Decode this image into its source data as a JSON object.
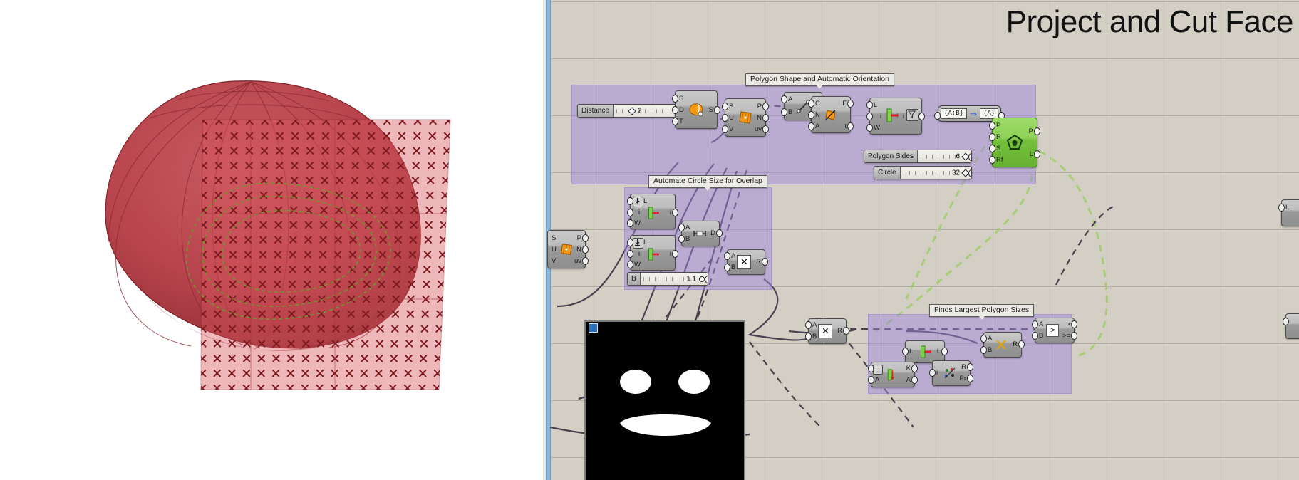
{
  "window": {
    "title": "Project and Cut Face"
  },
  "viewport": {
    "name": "rhino-viewport",
    "description": "Shaded red lofted blob surface with a translucent red rectangular mesh plane covered in X cross markers and green dashed curve overlay",
    "shape_color": "#b03b45",
    "plane_color": "#e09a9d",
    "marker_color": "#8c1c22",
    "curve_color": "#5f8f2a"
  },
  "canvas": {
    "background": "#d4cfc4",
    "grid_color": "#96918 7",
    "group_color": "#9f84e0",
    "wire_color": "#4a4050",
    "green_wire_color": "#a8cc7a"
  },
  "groups": [
    {
      "id": "g1",
      "label": "Polygon Shape and Automatic Orientation"
    },
    {
      "id": "g2",
      "label": "Automate Circle Size for Overlap"
    },
    {
      "id": "g3",
      "label": "Finds Largest Polygon Sizes"
    }
  ],
  "sliders": [
    {
      "name": "Distance",
      "value": "2",
      "knob": "diamond"
    },
    {
      "name": "Polygon Sides",
      "value": "6",
      "knob": "diamond"
    },
    {
      "name": "Circle",
      "value": "32",
      "knob": "diamond"
    },
    {
      "name": "B",
      "value": "1.1",
      "knob": "round"
    }
  ],
  "mapper": {
    "from": "{A;B}",
    "to": "{A}",
    "arrow": "⇒"
  },
  "components": [
    {
      "id": "c-divide",
      "icon": "divide-surface-icon",
      "inputs": [
        "S",
        "D",
        "T"
      ],
      "outputs": [
        "S"
      ]
    },
    {
      "id": "c-evalsrf1",
      "icon": "evaluate-surface-icon",
      "inputs": [
        "S",
        "U",
        "V"
      ],
      "outputs": [
        "P",
        "N",
        "uv"
      ]
    },
    {
      "id": "c-line",
      "icon": "line-icon",
      "inputs": [
        "A",
        "B"
      ],
      "outputs": [
        "L"
      ]
    },
    {
      "id": "c-planenorm",
      "icon": "plane-normal-icon",
      "inputs": [
        "C",
        "N",
        "A"
      ],
      "outputs": [
        "F",
        "t"
      ]
    },
    {
      "id": "c-flip1",
      "icon": "flip-plane-icon",
      "inputs": [
        "L",
        "i",
        "W"
      ],
      "outputs": [
        "i",
        "filter"
      ]
    },
    {
      "id": "c-pathmap",
      "icon": "path-mapper-icon",
      "inputs": [],
      "outputs": []
    },
    {
      "id": "c-polygon",
      "icon": "polygon-icon",
      "inputs": [
        "P",
        "R",
        "S",
        "Rf"
      ],
      "outputs": [
        "P",
        "L"
      ],
      "color": "green"
    },
    {
      "id": "c-evalsrf2",
      "icon": "evaluate-surface-icon",
      "inputs": [
        "S",
        "U",
        "V"
      ],
      "outputs": [
        "P",
        "N",
        "uv"
      ]
    },
    {
      "id": "c-flip2",
      "icon": "flip-plane-icon",
      "inputs": [
        "L",
        "i",
        "W"
      ],
      "outputs": [
        "i"
      ]
    },
    {
      "id": "c-flip3",
      "icon": "flip-plane-icon",
      "inputs": [
        "L",
        "i",
        "W"
      ],
      "outputs": [
        "i"
      ]
    },
    {
      "id": "c-dist",
      "icon": "distance-icon",
      "inputs": [
        "A",
        "B"
      ],
      "outputs": [
        "D"
      ]
    },
    {
      "id": "c-mult1",
      "icon": "multiplication-icon",
      "inputs": [
        "A",
        "B"
      ],
      "outputs": [
        "R"
      ]
    },
    {
      "id": "c-mult2",
      "icon": "multiplication-icon",
      "inputs": [
        "A",
        "B"
      ],
      "outputs": [
        "R"
      ]
    },
    {
      "id": "c-mult3",
      "icon": "multiplication-icon",
      "inputs": [
        "A",
        "B"
      ],
      "outputs": [
        "R"
      ]
    },
    {
      "id": "c-larger",
      "icon": "larger-than-icon",
      "inputs": [
        "A",
        "B"
      ],
      "outputs": [
        ">",
        ">="
      ]
    },
    {
      "id": "c-cull",
      "icon": "cull-pattern-icon",
      "inputs": [
        "A",
        "B"
      ],
      "outputs": [
        "R"
      ]
    },
    {
      "id": "c-list1",
      "icon": "list-item-icon",
      "inputs": [
        "L",
        "i",
        "W"
      ],
      "outputs": [
        "L"
      ]
    },
    {
      "id": "c-sort",
      "icon": "sort-list-icon",
      "inputs": [
        "K",
        "A"
      ],
      "outputs": [
        "K",
        "A"
      ]
    },
    {
      "id": "c-split",
      "icon": "split-tree-icon",
      "inputs": [
        "i"
      ],
      "outputs": [
        "R",
        "Pr"
      ]
    }
  ],
  "right_edge": {
    "partial_node_label": "L"
  }
}
